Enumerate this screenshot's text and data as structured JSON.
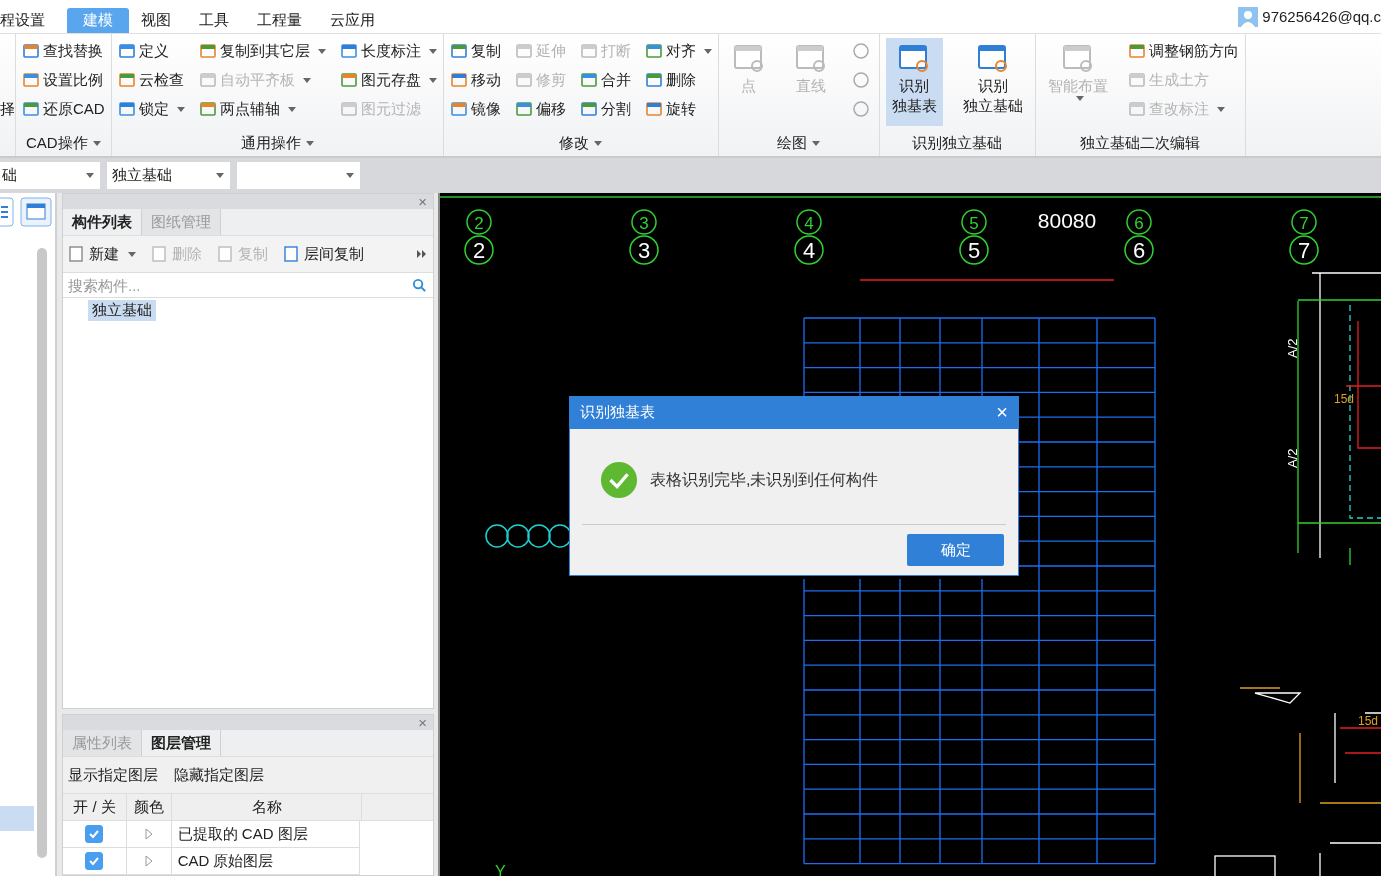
{
  "menu_tabs": [
    {
      "label": "程设置",
      "selected": false
    },
    {
      "label": "建模",
      "selected": true
    },
    {
      "label": "视图",
      "selected": false
    },
    {
      "label": "工具",
      "selected": false
    },
    {
      "label": "工程量",
      "selected": false
    },
    {
      "label": "云应用",
      "selected": false
    }
  ],
  "user": {
    "name": "976256426@qq.c"
  },
  "ribbon_groups": [
    {
      "columns": [
        [
          {
            "kind": "label",
            "label": "择"
          }
        ]
      ]
    },
    {
      "title": "CAD操作",
      "dropdown": true,
      "columns": [
        [
          {
            "kind": "small",
            "label": "查找替换",
            "disabled": false,
            "dropdown": false
          },
          {
            "kind": "small",
            "label": "设置比例",
            "disabled": false,
            "dropdown": false
          },
          {
            "kind": "small",
            "label": "还原CAD",
            "disabled": false,
            "dropdown": false
          }
        ]
      ]
    },
    {
      "title": "通用操作",
      "dropdown": true,
      "columns": [
        [
          {
            "kind": "small",
            "label": "定义",
            "disabled": false,
            "dropdown": false
          },
          {
            "kind": "small",
            "label": "云检查",
            "disabled": false,
            "dropdown": false
          },
          {
            "kind": "small",
            "label": "锁定",
            "disabled": false,
            "dropdown": true
          }
        ],
        [
          {
            "kind": "small",
            "label": "复制到其它层",
            "disabled": false,
            "dropdown": true
          },
          {
            "kind": "small",
            "label": "自动平齐板",
            "disabled": true,
            "dropdown": true
          },
          {
            "kind": "small",
            "label": "两点辅轴",
            "disabled": false,
            "dropdown": true
          }
        ],
        [
          {
            "kind": "small",
            "label": "长度标注",
            "disabled": false,
            "dropdown": true
          },
          {
            "kind": "small",
            "label": "图元存盘",
            "disabled": false,
            "dropdown": true
          },
          {
            "kind": "small",
            "label": "图元过滤",
            "disabled": true,
            "dropdown": false
          }
        ]
      ]
    },
    {
      "title": "修改",
      "dropdown": true,
      "columns": [
        [
          {
            "kind": "small",
            "label": "复制",
            "disabled": false,
            "dropdown": false
          },
          {
            "kind": "small",
            "label": "移动",
            "disabled": false,
            "dropdown": false
          },
          {
            "kind": "small",
            "label": "镜像",
            "disabled": false,
            "dropdown": false
          }
        ],
        [
          {
            "kind": "small",
            "label": "延伸",
            "disabled": true,
            "dropdown": false
          },
          {
            "kind": "small",
            "label": "修剪",
            "disabled": true,
            "dropdown": false
          },
          {
            "kind": "small",
            "label": "偏移",
            "disabled": false,
            "dropdown": false
          }
        ],
        [
          {
            "kind": "small",
            "label": "打断",
            "disabled": true,
            "dropdown": false
          },
          {
            "kind": "small",
            "label": "合并",
            "disabled": false,
            "dropdown": false
          },
          {
            "kind": "small",
            "label": "分割",
            "disabled": false,
            "dropdown": false
          }
        ],
        [
          {
            "kind": "small",
            "label": "对齐",
            "disabled": false,
            "dropdown": true
          },
          {
            "kind": "small",
            "label": "删除",
            "disabled": false,
            "dropdown": false
          },
          {
            "kind": "small",
            "label": "旋转",
            "disabled": false,
            "dropdown": false
          }
        ]
      ]
    },
    {
      "title": "绘图",
      "dropdown": true,
      "columns": [
        [
          {
            "kind": "large",
            "lines": [
              "点"
            ],
            "disabled": true,
            "selected": false,
            "dropdown": false
          }
        ],
        [
          {
            "kind": "large",
            "lines": [
              "直线"
            ],
            "disabled": true,
            "selected": false,
            "dropdown": false
          }
        ],
        [
          {
            "kind": "icon",
            "disabled": true
          },
          {
            "kind": "icon",
            "disabled": true
          },
          {
            "kind": "icon",
            "disabled": true
          }
        ]
      ]
    },
    {
      "title": "识别独立基础",
      "dropdown": false,
      "columns": [
        [
          {
            "kind": "large",
            "lines": [
              "识别",
              "独基表"
            ],
            "disabled": false,
            "selected": true,
            "dropdown": false
          }
        ],
        [
          {
            "kind": "large",
            "lines": [
              "识别",
              "独立基础"
            ],
            "disabled": false,
            "selected": false,
            "dropdown": false
          }
        ]
      ]
    },
    {
      "title": "独立基础二次编辑",
      "dropdown": false,
      "columns": [
        [
          {
            "kind": "large",
            "lines": [
              "智能布置"
            ],
            "disabled": true,
            "selected": false,
            "dropdown": true
          }
        ],
        [
          {
            "kind": "small",
            "label": "调整钢筋方向",
            "disabled": false,
            "dropdown": false
          },
          {
            "kind": "small",
            "label": "生成土方",
            "disabled": true,
            "dropdown": false
          },
          {
            "kind": "small",
            "label": "查改标注",
            "disabled": true,
            "dropdown": true
          }
        ]
      ]
    }
  ],
  "selectors": [
    {
      "kind": "dropdown",
      "value": "础"
    },
    {
      "kind": "dropdown",
      "value": "独立基础"
    },
    {
      "kind": "dropdown"
    }
  ],
  "component_panel": {
    "close": "×",
    "tabs": [
      {
        "label": "构件列表",
        "selected": true
      },
      {
        "label": "图纸管理",
        "selected": false
      }
    ],
    "toolbar": [
      {
        "label": "新建",
        "disabled": false,
        "dropdown": true
      },
      {
        "label": "删除",
        "disabled": true,
        "dropdown": false
      },
      {
        "label": "复制",
        "disabled": true,
        "dropdown": false
      },
      {
        "label": "层间复制",
        "disabled": false,
        "dropdown": false
      }
    ],
    "search": {
      "placeholder": "搜索构件..."
    },
    "items": [
      {
        "label": "独立基础",
        "selected": true
      }
    ]
  },
  "layer_panel": {
    "close": "×",
    "tabs": [
      {
        "label": "属性列表",
        "selected": false
      },
      {
        "label": "图层管理",
        "selected": true
      }
    ],
    "actions": [
      "显示指定图层",
      "隐藏指定图层"
    ],
    "columns": [
      "开 / 关",
      "颜色",
      "名称"
    ],
    "rows": [
      {
        "checked": true,
        "name": "已提取的 CAD 图层"
      },
      {
        "checked": true,
        "name": "CAD 原始图层"
      }
    ]
  },
  "canvas": {
    "axes": [
      {
        "top_label": "2",
        "label": "2"
      },
      {
        "top_label": "3",
        "label": "3"
      },
      {
        "top_label": "4",
        "label": "4"
      },
      {
        "top_label": "5",
        "label": "5"
      },
      {
        "top_label": "6",
        "label": "6"
      },
      {
        "top_label": "7",
        "label": "7"
      }
    ],
    "dimension": "80080",
    "side_labels": [
      "A/2",
      "A/2"
    ],
    "detail_labels": [
      "15d",
      "15d"
    ],
    "axis_marker": "Y"
  },
  "dialog": {
    "title": "识别独基表",
    "close": "×",
    "message": "表格识别完毕,未识别到任何构件",
    "button": "确定"
  }
}
